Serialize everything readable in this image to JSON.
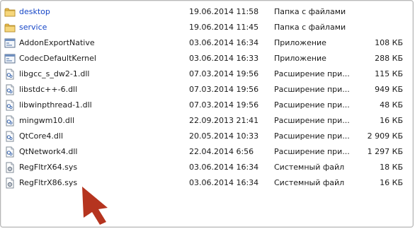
{
  "files": [
    {
      "name": "desktop",
      "date": "19.06.2014 11:58",
      "type": "Папка с файлами",
      "size": "",
      "kind": "folder",
      "icon": "folder-icon"
    },
    {
      "name": "service",
      "date": "19.06.2014 11:45",
      "type": "Папка с файлами",
      "size": "",
      "kind": "folder",
      "icon": "folder-icon"
    },
    {
      "name": "AddonExportNative",
      "date": "03.06.2014 16:34",
      "type": "Приложение",
      "size": "108 КБ",
      "kind": "app",
      "icon": "application-icon"
    },
    {
      "name": "CodecDefaultKernel",
      "date": "03.06.2014 16:33",
      "type": "Приложение",
      "size": "288 КБ",
      "kind": "app",
      "icon": "application-icon"
    },
    {
      "name": "libgcc_s_dw2-1.dll",
      "date": "07.03.2014 19:56",
      "type": "Расширение при...",
      "size": "115 КБ",
      "kind": "dll",
      "icon": "dll-file-icon"
    },
    {
      "name": "libstdc++-6.dll",
      "date": "07.03.2014 19:56",
      "type": "Расширение при...",
      "size": "949 КБ",
      "kind": "dll",
      "icon": "dll-file-icon"
    },
    {
      "name": "libwinpthread-1.dll",
      "date": "07.03.2014 19:56",
      "type": "Расширение при...",
      "size": "48 КБ",
      "kind": "dll",
      "icon": "dll-file-icon"
    },
    {
      "name": "mingwm10.dll",
      "date": "22.09.2013 21:41",
      "type": "Расширение при...",
      "size": "16 КБ",
      "kind": "dll",
      "icon": "dll-file-icon"
    },
    {
      "name": "QtCore4.dll",
      "date": "20.05.2014 10:33",
      "type": "Расширение при...",
      "size": "2 909 КБ",
      "kind": "dll",
      "icon": "dll-file-icon"
    },
    {
      "name": "QtNetwork4.dll",
      "date": "22.04.2014 6:56",
      "type": "Расширение при...",
      "size": "1 297 КБ",
      "kind": "dll",
      "icon": "dll-file-icon"
    },
    {
      "name": "RegFltrX64.sys",
      "date": "03.06.2014 16:34",
      "type": "Системный файл",
      "size": "18 КБ",
      "kind": "sys",
      "icon": "system-file-icon"
    },
    {
      "name": "RegFltrX86.sys",
      "date": "03.06.2014 16:34",
      "type": "Системный файл",
      "size": "16 КБ",
      "kind": "sys",
      "icon": "system-file-icon"
    }
  ],
  "annotation": {
    "icon": "pointer-arrow-icon",
    "color": "#b5341f"
  }
}
